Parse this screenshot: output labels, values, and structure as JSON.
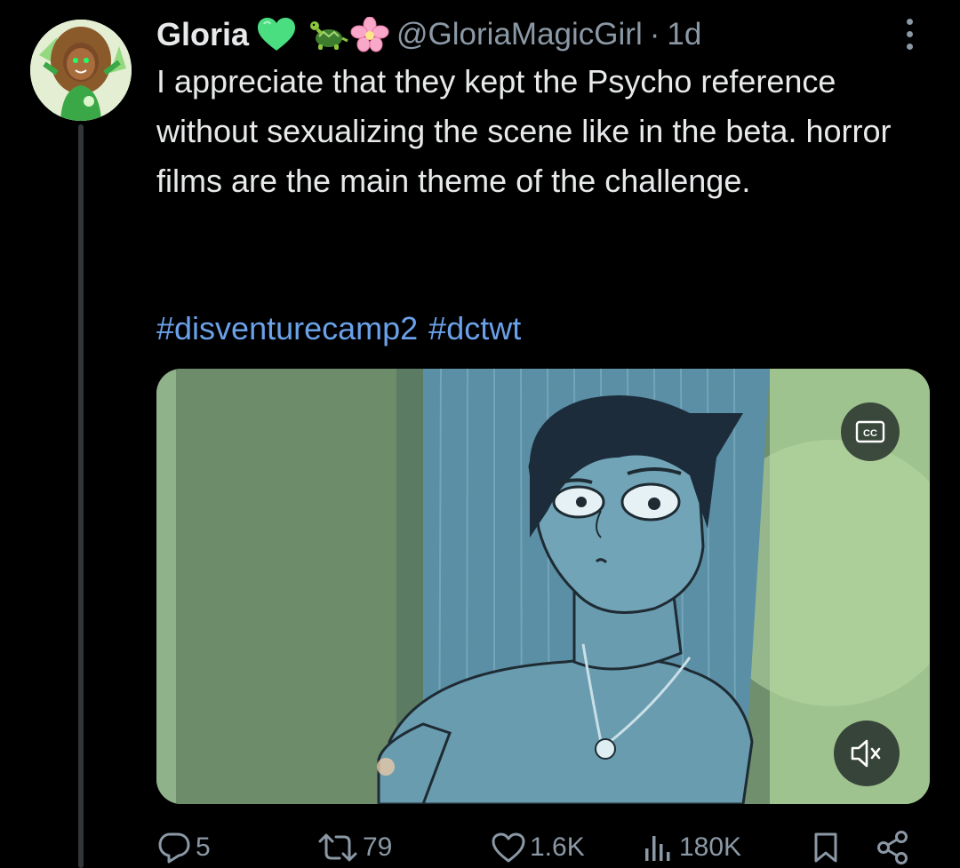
{
  "author": {
    "display_name": "Gloria",
    "emojis": [
      "green-heart-icon",
      "turtle-icon",
      "cherry-blossom-icon"
    ],
    "handle": "@GloriaMagicGirl",
    "separator": "·",
    "time": "1d"
  },
  "tweet": {
    "text": "I appreciate that they kept the Psycho reference without sexualizing the scene like in the beta. horror films are the main theme of the challenge.",
    "hashtags": [
      "#disventurecamp2",
      "#dctwt"
    ]
  },
  "media": {
    "type": "video",
    "cc_icon": "closed-captions-icon",
    "cc_label": "CC",
    "mute_icon": "volume-muted-icon"
  },
  "actions": {
    "reply_count": "5",
    "retweet_count": "79",
    "like_count": "1.6K",
    "views_count": "180K"
  },
  "colors": {
    "background": "#000000",
    "text": "#e7e9ea",
    "secondary": "#8b98a5",
    "link": "#6aa1e8",
    "heart_emoji": "#4ade80"
  }
}
